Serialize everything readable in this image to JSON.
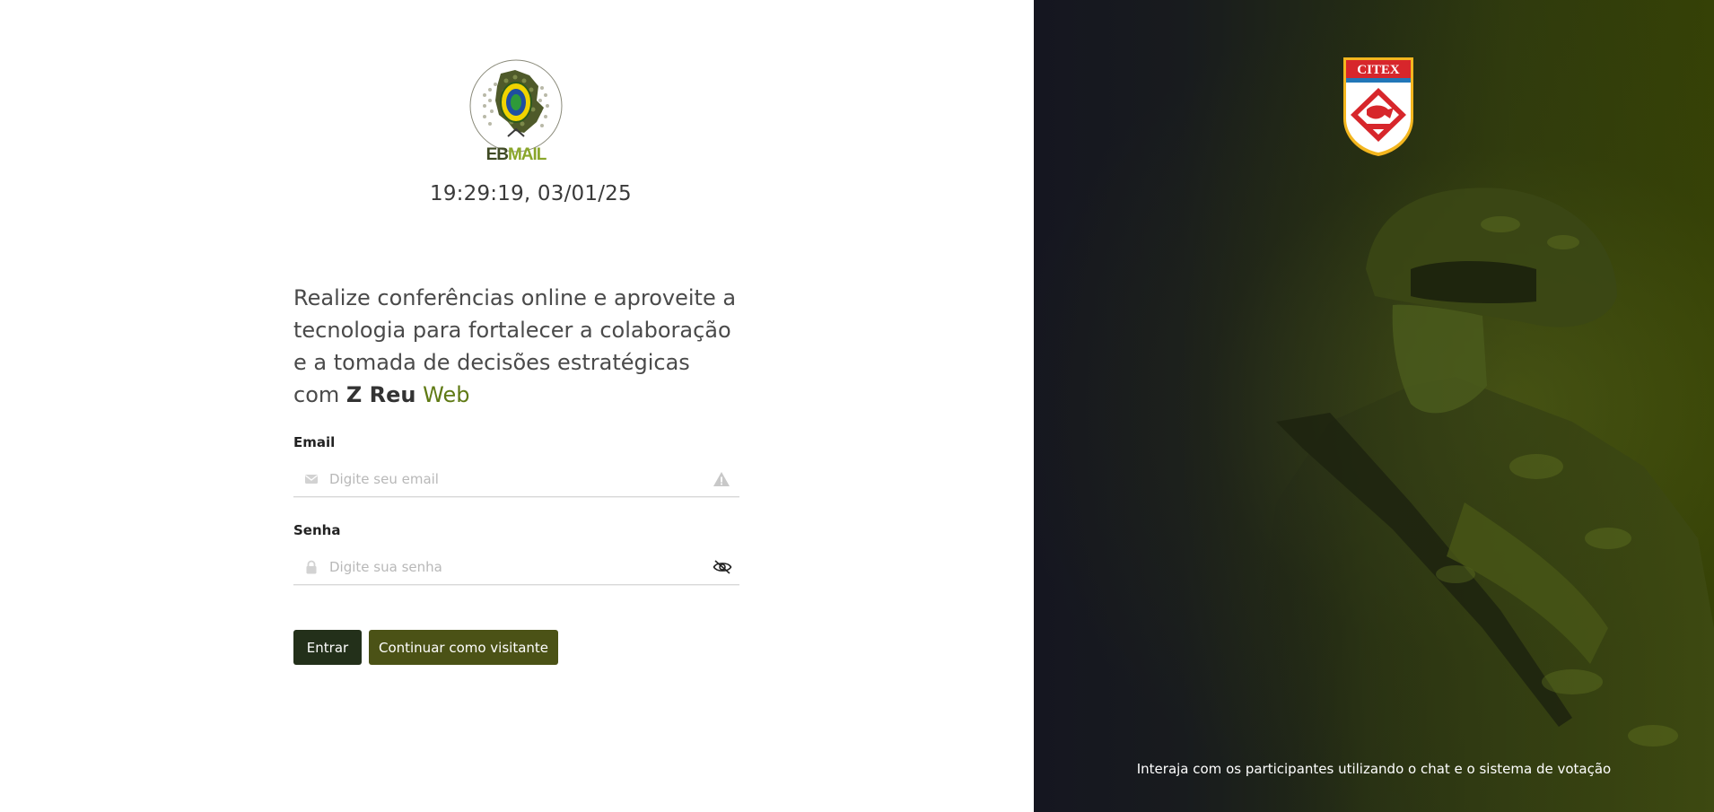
{
  "login": {
    "logo_text": "EBMAIL",
    "datetime": "19:29:19, 03/01/25",
    "headline_prefix": "Realize conferências online e aproveite a tecnologia para fortalecer a colaboração e a tomada de decisões estratégicas com ",
    "headline_brand": "Z Reu",
    "headline_brand_accent": "Web",
    "email_label": "Email",
    "email_placeholder": "Digite seu email",
    "email_value": "",
    "password_label": "Senha",
    "password_placeholder": "Digite sua senha",
    "password_value": "",
    "enter_button": "Entrar",
    "guest_button": "Continuar como visitante"
  },
  "side_panel": {
    "emblem_text": "CITEX",
    "footer_text": "Interaja com os participantes utilizando o chat e o sistema de votação"
  },
  "icons": {
    "email_left": "envelope-icon",
    "email_right": "warning-icon",
    "password_left": "lock-icon",
    "password_right": "eye-slash-icon"
  },
  "colors": {
    "enter_button": "#23301a",
    "guest_button": "#4b5216",
    "brand_accent": "#5f7a14",
    "panel_dark": "#151620",
    "panel_olive": "#354106"
  }
}
